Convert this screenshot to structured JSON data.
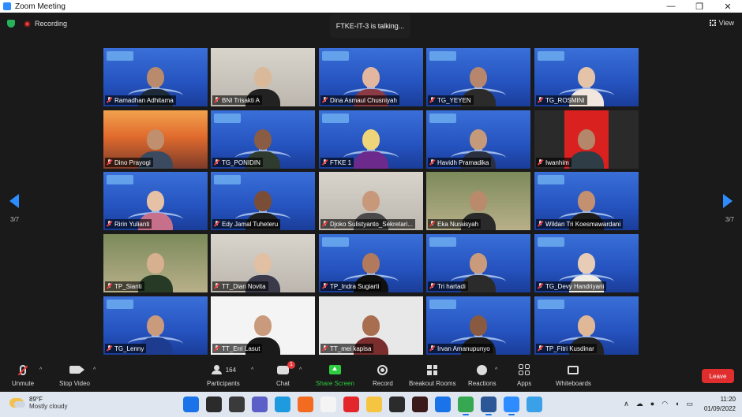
{
  "window": {
    "title": "Zoom Meeting",
    "controls": [
      "—",
      "❐",
      "✕"
    ]
  },
  "meeting": {
    "recording_label": "Recording",
    "talking_label": "FTKE-IT-3 is talking...",
    "view_label": "View",
    "page_left": "3/7",
    "page_right": "3/7"
  },
  "participants": [
    {
      "name": "Ramadhan Adhitama",
      "style": "stage",
      "skin": "#b98a6b",
      "shirt": "#1d2a3a"
    },
    {
      "name": "BNI Trisakti A",
      "style": "room",
      "skin": "#d9b99a",
      "shirt": "#222"
    },
    {
      "name": "Dina Asmaul Chusniyah",
      "style": "stage",
      "skin": "#e3b6a0",
      "shirt": "#8a3b46"
    },
    {
      "name": "TG_YEYEN",
      "style": "stage",
      "skin": "#b7866c",
      "shirt": "#2b2b2b"
    },
    {
      "name": "TG_ROSMINI",
      "style": "stage",
      "skin": "#e5c3a8",
      "shirt": "#f1e7de"
    },
    {
      "name": "Dino Prayogi",
      "style": "sunset",
      "skin": "#c0906e",
      "shirt": "#3b4a5f"
    },
    {
      "name": "TG_PONIDIN",
      "style": "stage",
      "skin": "#8a5c44",
      "shirt": "#2e3b2e"
    },
    {
      "name": "FTKE 1",
      "style": "stage",
      "skin": "#f0d47a",
      "shirt": "#6c2a8c"
    },
    {
      "name": "Havidh Pramadika",
      "style": "stage",
      "skin": "#c59a7a",
      "shirt": "#2a3040"
    },
    {
      "name": "Iwanhim",
      "style": "red",
      "skin": "#b4866a",
      "shirt": "#2f3d46"
    },
    {
      "name": "Ririn Yulianti",
      "style": "stage",
      "skin": "#e6c1a6",
      "shirt": "#c6708c"
    },
    {
      "name": "Edy Jamal Tuheteru",
      "style": "stage",
      "skin": "#7a4e36",
      "shirt": "#1e1e1e"
    },
    {
      "name": "Djoko Sulistyanto_Sekretari...",
      "style": "room",
      "skin": "#c7987a",
      "shirt": "#4a4a4a"
    },
    {
      "name": "Eka Nuraisyah",
      "style": "green",
      "skin": "#b98a6b",
      "shirt": "#2a2a2a"
    },
    {
      "name": "Wildan Tri Koesmawardani",
      "style": "stage",
      "skin": "#c39070",
      "shirt": "#1c1c1c"
    },
    {
      "name": "TP_Sianti",
      "style": "green",
      "skin": "#d7b090",
      "shirt": "#263a26"
    },
    {
      "name": "TT_Dian Novita",
      "style": "room",
      "skin": "#e1c0a4",
      "shirt": "#3a3a4a"
    },
    {
      "name": "TP_Indra Sugiarti",
      "style": "stage",
      "skin": "#b27a5c",
      "shirt": "#111"
    },
    {
      "name": "Tri hartadi",
      "style": "stage",
      "skin": "#c99a7c",
      "shirt": "#2b2b2b"
    },
    {
      "name": "TG_Devy Handriyani",
      "style": "stage",
      "skin": "#e7cdb6",
      "shirt": "#f0ece6"
    },
    {
      "name": "TG_Lenny",
      "style": "stage",
      "skin": "#c99a7c",
      "shirt": "#1e3c8f"
    },
    {
      "name": "TT_Erri Lasut",
      "style": "poster",
      "skin": "#c99a7c",
      "shirt": "#1a1a1a"
    },
    {
      "name": "TT_mei kapisa",
      "style": "white",
      "skin": "#a96e50",
      "shirt": "#7a2e2e"
    },
    {
      "name": "Irvan Amanupunyo",
      "style": "stage",
      "skin": "#8a5a40",
      "shirt": "#1a1a1a"
    },
    {
      "name": "TP_Fitri Kusdinar",
      "style": "stage",
      "skin": "#e0b898",
      "shirt": "#222"
    }
  ],
  "toolbar": {
    "unmute": "Unmute",
    "stop_video": "Stop Video",
    "participants": "Participants",
    "participants_count": "164",
    "chat": "Chat",
    "chat_badge": "1",
    "share": "Share Screen",
    "record": "Record",
    "rooms": "Breakout Rooms",
    "reactions": "Reactions",
    "apps": "Apps",
    "whiteboards": "Whiteboards",
    "leave": "Leave"
  },
  "taskbar": {
    "weather_temp": "89°F",
    "weather_desc": "Mostly cloudy",
    "tray_caret": "∧",
    "time": "11:20",
    "date": "01/09/2022",
    "apps": [
      {
        "name": "windows-start-icon",
        "color": "#1a73e8"
      },
      {
        "name": "search-icon",
        "color": "#2b2b2b"
      },
      {
        "name": "task-view-icon",
        "color": "#3a3a3a"
      },
      {
        "name": "teams-icon",
        "color": "#5b5fc7"
      },
      {
        "name": "edge-icon",
        "color": "#1e9be0"
      },
      {
        "name": "firefox-icon",
        "color": "#f26b21"
      },
      {
        "name": "file-icon",
        "color": "#f4f4f4"
      },
      {
        "name": "opera-icon",
        "color": "#e3262a"
      },
      {
        "name": "folder-icon",
        "color": "#f5c542"
      },
      {
        "name": "dropbox-icon",
        "color": "#2b2b2b"
      },
      {
        "name": "obs-icon",
        "color": "#3a1a1a"
      },
      {
        "name": "mail-icon",
        "color": "#1a73e8"
      },
      {
        "name": "chrome-icon",
        "color": "#36a852"
      },
      {
        "name": "word-icon",
        "color": "#2b5797"
      },
      {
        "name": "zoom-icon",
        "color": "#2d8cff"
      },
      {
        "name": "photos-icon",
        "color": "#3aa0e8"
      }
    ]
  }
}
